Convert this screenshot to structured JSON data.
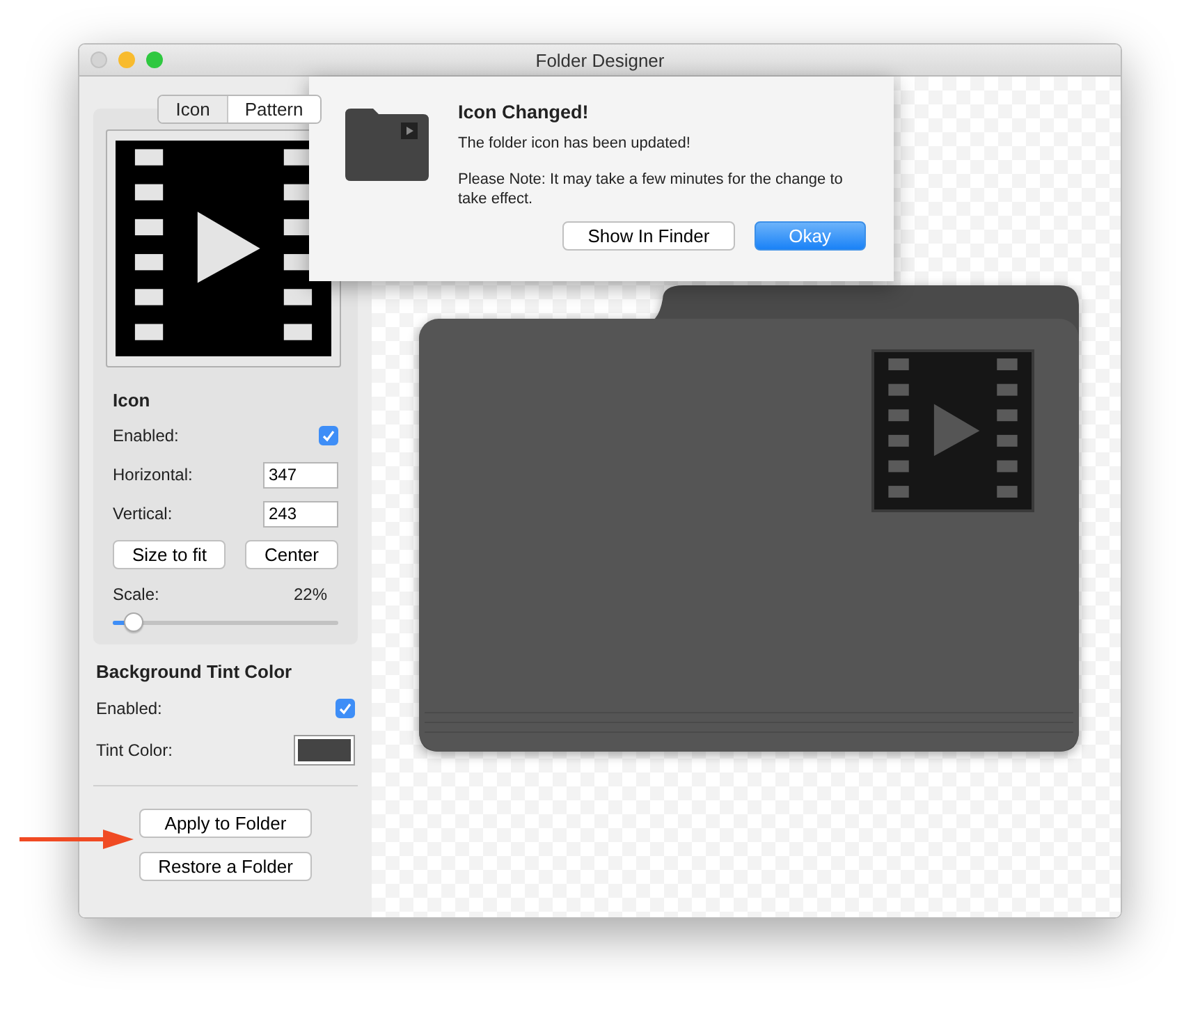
{
  "window": {
    "title": "Folder Designer"
  },
  "tabs": [
    {
      "label": "Icon",
      "selected": true
    },
    {
      "label": "Pattern",
      "selected": false
    }
  ],
  "icon_settings": {
    "heading": "Icon",
    "enabled_label": "Enabled:",
    "enabled": true,
    "horizontal_label": "Horizontal:",
    "horizontal_value": "347",
    "vertical_label": "Vertical:",
    "vertical_value": "243",
    "buttons": [
      "Size to fit",
      "Center"
    ],
    "scale_label": "Scale:",
    "scale_reading": "22%",
    "level": 0.09
  },
  "tint_settings": {
    "heading": "Background Tint Color",
    "enabled_label": "Enabled:",
    "enabled": true,
    "color_label": "Tint Color:",
    "color": "#444444"
  },
  "actions": [
    {
      "label": "Apply to Folder"
    },
    {
      "label": "Restore a Folder"
    }
  ],
  "dialog": {
    "title": "Icon Changed!",
    "message": "The folder icon has been updated!",
    "note": "Please Note: It may take a few minutes for the change to take effect.",
    "buttons": [
      {
        "label": "Show In Finder",
        "default": false
      },
      {
        "label": "Okay",
        "default": true
      }
    ]
  }
}
